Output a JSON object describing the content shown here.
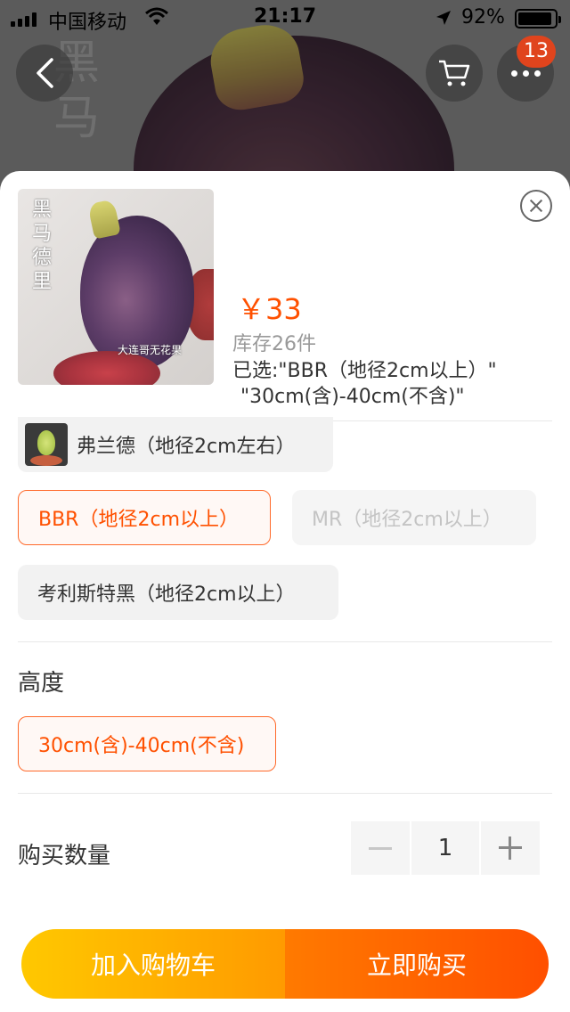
{
  "status_bar": {
    "carrier": "中国移动",
    "time": "21:17",
    "battery": "92%"
  },
  "background": {
    "calligraphy": "黑马",
    "cart_badge": "13"
  },
  "product": {
    "price": "￥33",
    "stock": "库存26件",
    "selected_line1": "已选:\"BBR（地径2cm以上）\"",
    "selected_line2": "\"30cm(含)-40cm(不含)\"",
    "thumb_calligraphy": "黑马德里",
    "thumb_watermark": "大连哥无花果"
  },
  "variety_options": [
    {
      "label": "弗兰德（地径2cm左右）",
      "state": "normal"
    },
    {
      "label": "BBR（地径2cm以上）",
      "state": "selected"
    },
    {
      "label": "MR（地径2cm以上）",
      "state": "disabled"
    },
    {
      "label": "考利斯特黑（地径2cm以上）",
      "state": "normal"
    }
  ],
  "height_section": {
    "title": "高度",
    "options": [
      {
        "label": "30cm(含)-40cm(不含)",
        "state": "selected"
      }
    ]
  },
  "quantity": {
    "label": "购买数量",
    "value": "1"
  },
  "actions": {
    "add_to_cart": "加入购物车",
    "buy_now": "立即购买"
  },
  "colors": {
    "accent": "#ff5000",
    "add_cart_gradient": [
      "#ffc800",
      "#ff9a00"
    ],
    "buy_now_gradient": [
      "#ff7a00",
      "#ff4f00"
    ],
    "badge": "#e0441d"
  }
}
